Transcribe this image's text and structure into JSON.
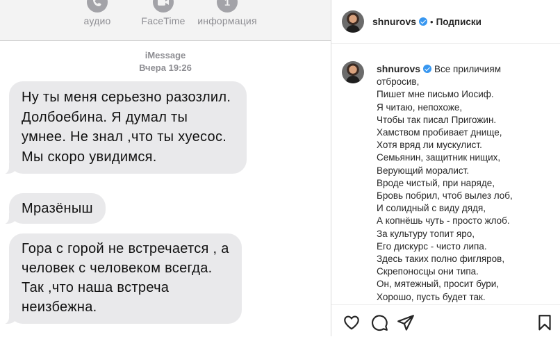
{
  "imessage": {
    "top_actions": [
      {
        "label": "аудио",
        "icon": "phone-icon"
      },
      {
        "label": "FaceTime",
        "icon": "video-camera-icon"
      },
      {
        "label": "информация",
        "icon": "info-icon"
      }
    ],
    "service": "iMessage",
    "timestamp": "Вчера 19:26",
    "messages": [
      "Ну ты меня серьезно разозлил. Долбоебина. Я думал ты умнее. Не знал ,что ты хуесос. Мы скоро увидимся.",
      "Мразёныш",
      "Гора с горой не встречается , а человек с человеком всегда. Так ,что наша встреча неизбежна."
    ]
  },
  "instagram": {
    "username": "shnurovs",
    "verified": true,
    "separator": "•",
    "follow_status": "Подписки",
    "caption_lines": [
      "Все приличиям",
      "отбросив,",
      "Пишет мне письмо Иосиф.",
      "Я читаю, непохоже,",
      "Чтобы так писал Пригожин.",
      "Хамством пробивает днище,",
      "Хотя вряд ли мускулист.",
      "Семьянин, защитник нищих,",
      "Верующий моралист.",
      "Вроде чистый, при наряде,",
      "Бровь побрил, чтоб вылез лоб,",
      "И солидный с виду дядя,",
      "А копнёшь чуть - просто жлоб.",
      "За культуру топит яро,",
      "Его дискурс - чисто липа.",
      "Здесь таких полно фигляров,",
      "Скрепоносцы они типа.",
      "Он, мятежный, просит бури,",
      "Хорошо, пусть будет так."
    ],
    "actions": [
      "heart-icon",
      "comment-icon",
      "share-icon",
      "bookmark-icon"
    ],
    "colors": {
      "verified": "#3897f0",
      "text": "#262626",
      "bubble": "#e9e9eb"
    }
  }
}
